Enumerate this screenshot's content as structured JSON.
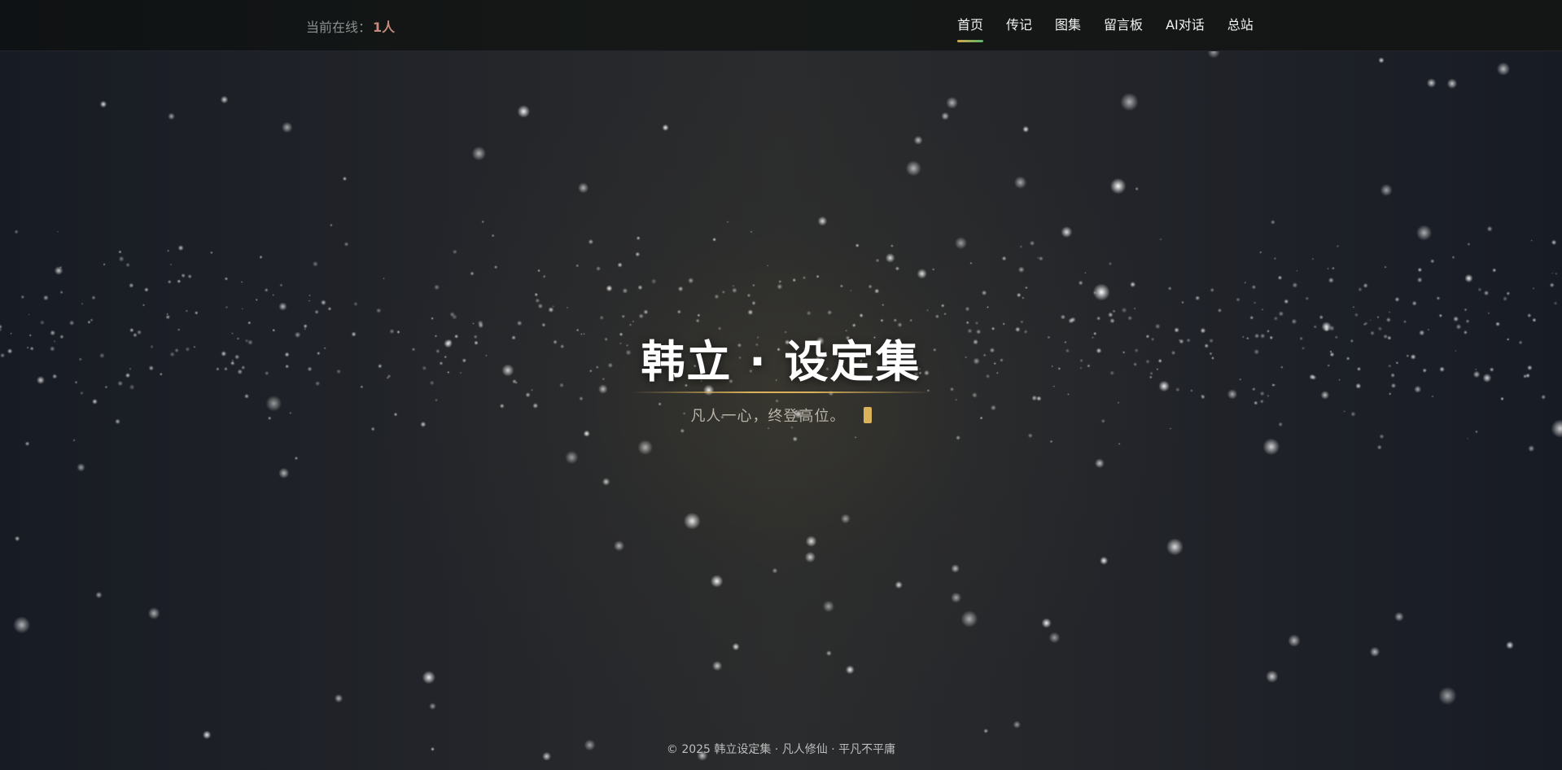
{
  "header": {
    "online_label": "当前在线：",
    "online_count": "1人",
    "nav": [
      {
        "label": "首页",
        "active": true
      },
      {
        "label": "传记",
        "active": false
      },
      {
        "label": "图集",
        "active": false
      },
      {
        "label": "留言板",
        "active": false
      },
      {
        "label": "AI对话",
        "active": false
      },
      {
        "label": "总站",
        "active": false
      }
    ]
  },
  "hero": {
    "title": "韩立 · 设定集",
    "subtitle": "凡人一心，终登高位。"
  },
  "footer": {
    "text": "© 2025 韩立设定集 · 凡人修仙 · 平凡不平庸"
  },
  "colors": {
    "accent_gold": "#d9b25a",
    "online_count": "#c58b7e",
    "nav_underline_start": "#d6a84a",
    "nav_underline_end": "#58b96a"
  }
}
